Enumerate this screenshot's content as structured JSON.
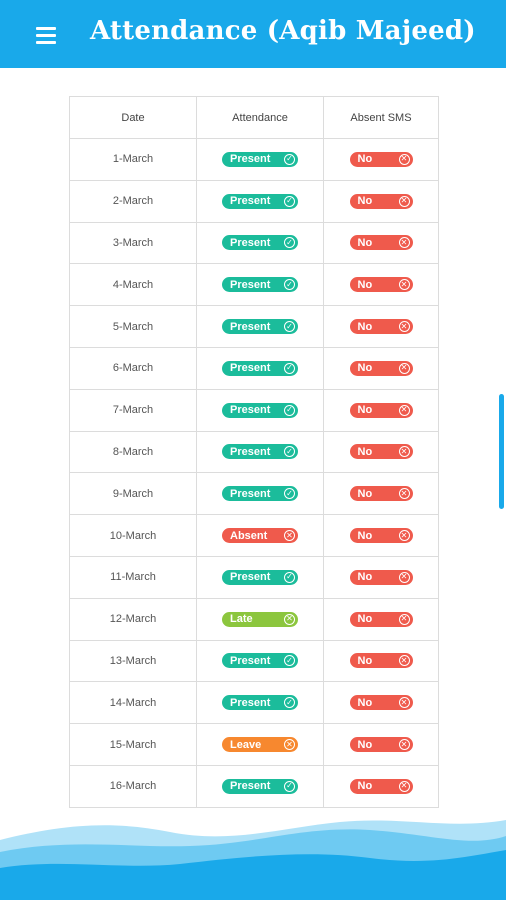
{
  "header": {
    "title": "Attendance (Aqib Majeed)",
    "menu_icon": "hamburger-menu-icon"
  },
  "table": {
    "columns": [
      "Date",
      "Attendance",
      "Absent SMS"
    ],
    "rows": [
      {
        "date": "1-March",
        "attendance": "Present",
        "sms": "No"
      },
      {
        "date": "2-March",
        "attendance": "Present",
        "sms": "No"
      },
      {
        "date": "3-March",
        "attendance": "Present",
        "sms": "No"
      },
      {
        "date": "4-March",
        "attendance": "Present",
        "sms": "No"
      },
      {
        "date": "5-March",
        "attendance": "Present",
        "sms": "No"
      },
      {
        "date": "6-March",
        "attendance": "Present",
        "sms": "No"
      },
      {
        "date": "7-March",
        "attendance": "Present",
        "sms": "No"
      },
      {
        "date": "8-March",
        "attendance": "Present",
        "sms": "No"
      },
      {
        "date": "9-March",
        "attendance": "Present",
        "sms": "No"
      },
      {
        "date": "10-March",
        "attendance": "Absent",
        "sms": "No"
      },
      {
        "date": "11-March",
        "attendance": "Present",
        "sms": "No"
      },
      {
        "date": "12-March",
        "attendance": "Late",
        "sms": "No"
      },
      {
        "date": "13-March",
        "attendance": "Present",
        "sms": "No"
      },
      {
        "date": "14-March",
        "attendance": "Present",
        "sms": "No"
      },
      {
        "date": "15-March",
        "attendance": "Leave",
        "sms": "No"
      },
      {
        "date": "16-March",
        "attendance": "Present",
        "sms": "No"
      }
    ]
  },
  "status_styles": {
    "Present": {
      "color": "#1bbc9b",
      "icon": "check-circle-icon"
    },
    "Absent": {
      "color": "#ef5a4c",
      "icon": "close-circle-icon"
    },
    "Late": {
      "color": "#8cc63e",
      "icon": "close-circle-icon"
    },
    "Leave": {
      "color": "#f7882f",
      "icon": "close-circle-icon"
    },
    "No": {
      "color": "#ef5a4c",
      "icon": "close-circle-icon"
    }
  },
  "colors": {
    "primary": "#19a9ea",
    "wave_light": "#8fd6f5",
    "wave_dark": "#19a9ea"
  }
}
